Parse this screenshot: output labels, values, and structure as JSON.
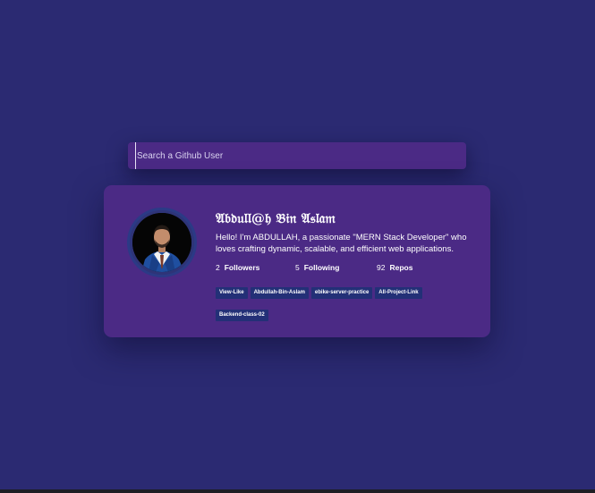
{
  "search": {
    "placeholder": "Search a Github User",
    "value": ""
  },
  "profile": {
    "name": "𝔄𝔟𝔡𝔲𝔩𝔩@𝔥 𝔅𝔦𝔫 𝔄𝔰𝔩𝔞𝔪",
    "bio": "Hello! I'm ABDULLAH, a passionate \"MERN Stack Developer\" who loves crafting dynamic, scalable, and efficient web applications.",
    "stats": {
      "followers_count": "2",
      "followers_label": "Followers",
      "following_count": "5",
      "following_label": "Following",
      "repos_count": "92",
      "repos_label": "Repos"
    },
    "repos": [
      "View-Like",
      "Abdullah-Bin-Aslam",
      "ebike-server-practice",
      "All-Project-Link",
      "Backend-class-02"
    ]
  },
  "colors": {
    "background": "#2b2a72",
    "card": "#4b2a85",
    "repo_tag": "#233077"
  }
}
